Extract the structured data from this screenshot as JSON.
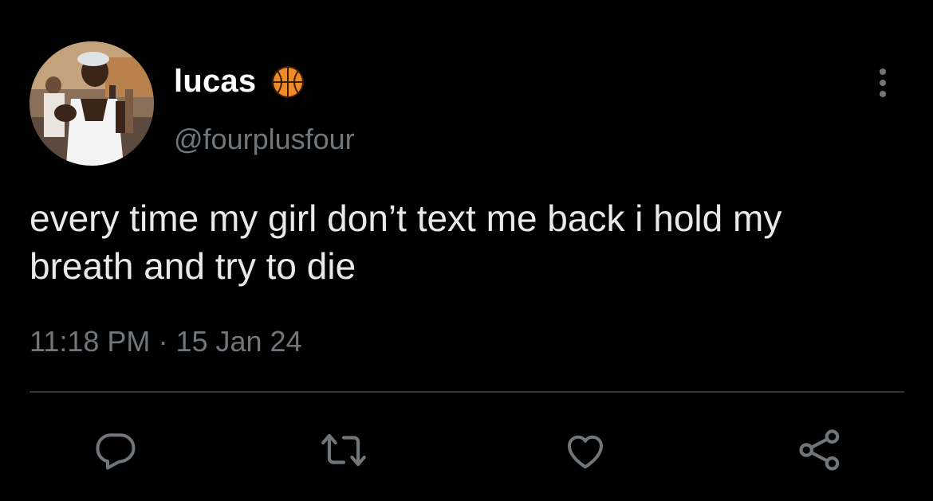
{
  "author": {
    "display_name": "lucas",
    "badge_emoji": "basketball-icon",
    "handle": "@fourplusfour"
  },
  "tweet": {
    "text": "every time my girl don’t text me back i hold my breath and try to die",
    "time": "11:18 PM",
    "separator": "·",
    "date": "15 Jan 24"
  },
  "actions": [
    {
      "name": "reply",
      "icon": "comment-icon"
    },
    {
      "name": "retweet",
      "icon": "retweet-icon"
    },
    {
      "name": "like",
      "icon": "heart-icon"
    },
    {
      "name": "share",
      "icon": "share-icon"
    }
  ],
  "colors": {
    "background": "#000000",
    "text": "#e7e9ea",
    "muted": "#71767b",
    "divider": "#2f3336",
    "icon": "#71767b"
  }
}
